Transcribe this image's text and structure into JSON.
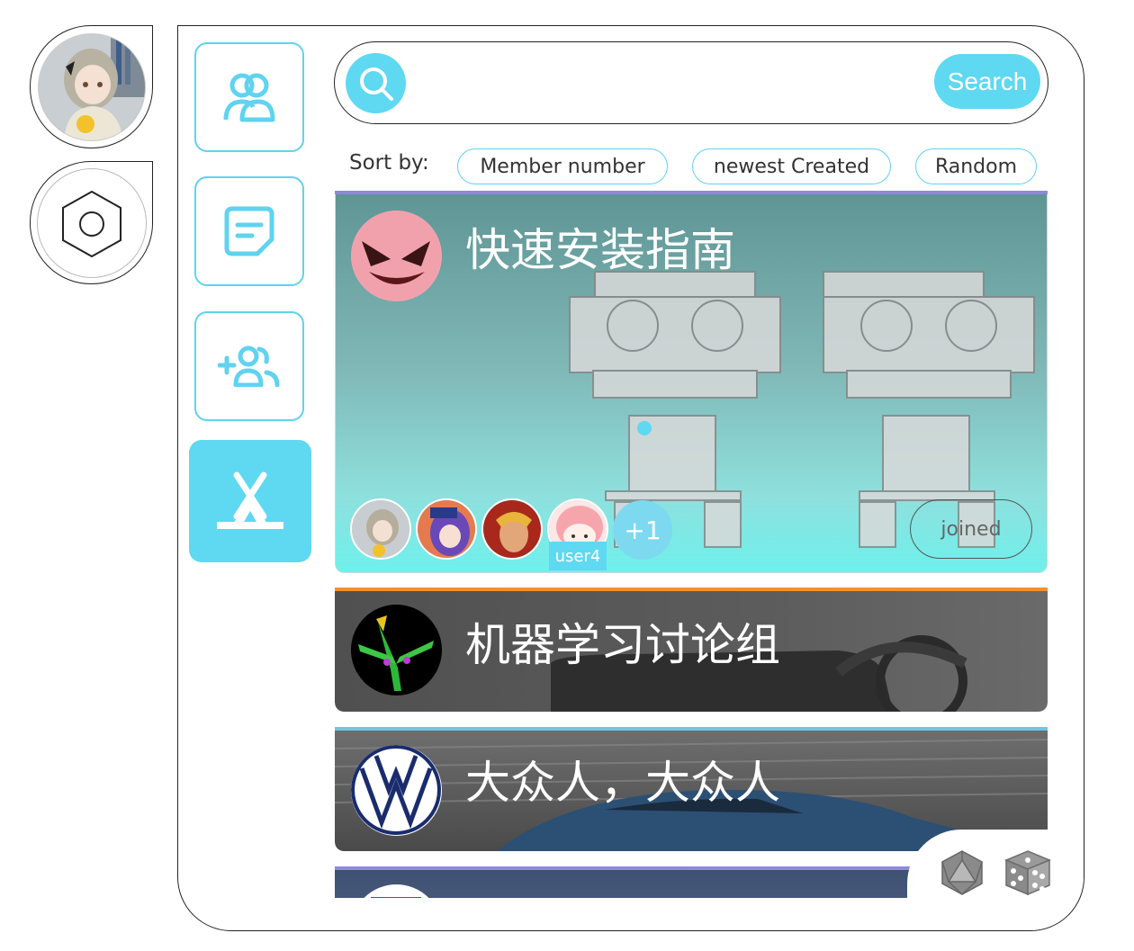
{
  "search": {
    "placeholder": "",
    "button_label": "Search"
  },
  "sort": {
    "label": "Sort by:",
    "options": [
      "Member number",
      "newest Created",
      "Random"
    ]
  },
  "groups": [
    {
      "title": "快速安装指南",
      "accent": "#8d8ad9",
      "more_members": "+1",
      "hovered_user": "user4",
      "join_label": "joined"
    },
    {
      "title": "机器学习讨论组",
      "accent": "#f3912f"
    },
    {
      "title": "大众人，大众人",
      "accent": "#6fc6e2"
    },
    {
      "title": "",
      "accent": "#8d8ad9"
    }
  ],
  "colors": {
    "accent": "#5fd8f2",
    "border": "#222222"
  },
  "icons": {
    "nav": [
      "friends-icon",
      "posts-icon",
      "add-group-icon",
      "camp-icon"
    ],
    "side": [
      "user-avatar",
      "settings-hex-icon"
    ],
    "dice": [
      "d20-icon",
      "dice-icon"
    ]
  }
}
